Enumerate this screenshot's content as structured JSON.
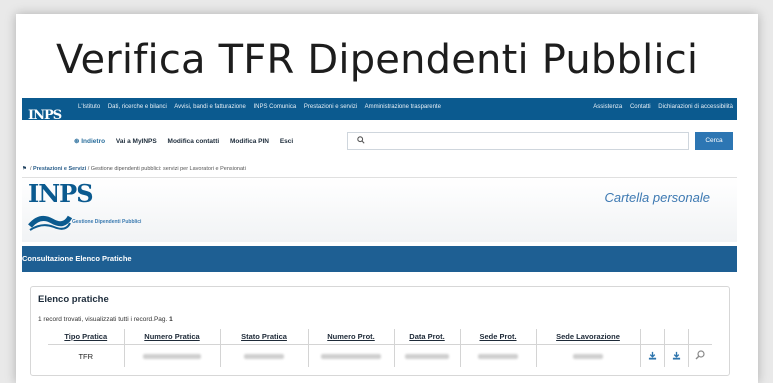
{
  "headline": "Verifica TFR Dipendenti Pubblici",
  "logo_text": "INPS",
  "top_links_left": [
    "L'Istituto",
    "Dati, ricerche e bilanci",
    "Avvisi, bandi e fatturazione",
    "INPS Comunica",
    "Prestazioni e servizi",
    "Amministrazione trasparente"
  ],
  "top_links_right": [
    "Assistenza",
    "Contatti",
    "Dichiarazioni di accessibilità"
  ],
  "subnav": {
    "back": "⊛ Indietro",
    "items": [
      "Vai a MyINPS",
      "Modifica contatti",
      "Modifica PIN",
      "Esci"
    ]
  },
  "search": {
    "placeholder": "",
    "button": "Cerca"
  },
  "breadcrumb": {
    "home_icon": "home-icon",
    "section": "Prestazioni e Servizi",
    "current": "Gestione dipendenti pubblici: servizi per Lavoratori e Pensionati"
  },
  "band": {
    "sublogo": "Gestione Dipendenti Pubblici",
    "cartella": "Cartella personale"
  },
  "section_title": "Consultazione Elenco Pratiche",
  "panel": {
    "title": "Elenco pratiche",
    "record_info": "1 record trovati, visualizzati tutti i record.Pag. ",
    "page": "1"
  },
  "table": {
    "headers": [
      "Tipo Pratica",
      "Numero Pratica",
      "Stato Pratica",
      "Numero Prot.",
      "Data Prot.",
      "Sede Prot.",
      "Sede Lavorazione"
    ],
    "rows": [
      {
        "tipo": "TFR"
      }
    ],
    "row_icons": [
      "download-icon",
      "download-icon",
      "search-icon"
    ]
  },
  "colors": {
    "nav_blue": "#0b5a8f",
    "section_blue": "#1e5f93",
    "accent": "#2d76b3"
  }
}
